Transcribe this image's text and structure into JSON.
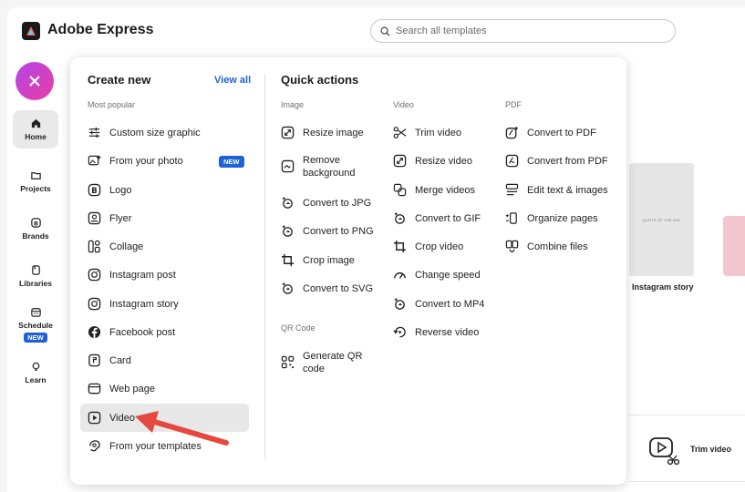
{
  "app": {
    "title": "Adobe Express"
  },
  "search": {
    "placeholder": "Search all templates"
  },
  "rail": {
    "items": [
      {
        "label": "Home",
        "icon": "home-icon"
      },
      {
        "label": "Projects",
        "icon": "folder-icon"
      },
      {
        "label": "Brands",
        "icon": "brand-icon"
      },
      {
        "label": "Libraries",
        "icon": "library-icon"
      },
      {
        "label": "Schedule",
        "icon": "calendar-icon",
        "badge": "NEW"
      },
      {
        "label": "Learn",
        "icon": "lightbulb-icon"
      }
    ]
  },
  "create_new": {
    "title": "Create new",
    "view_all": "View all",
    "section": "Most popular",
    "items": [
      {
        "label": "Custom size graphic",
        "icon": "sliders-icon"
      },
      {
        "label": "From your photo",
        "icon": "photo-magic-icon",
        "badge": "NEW"
      },
      {
        "label": "Logo",
        "icon": "logo-icon"
      },
      {
        "label": "Flyer",
        "icon": "flyer-icon"
      },
      {
        "label": "Collage",
        "icon": "collage-icon"
      },
      {
        "label": "Instagram post",
        "icon": "instagram-icon"
      },
      {
        "label": "Instagram story",
        "icon": "instagram-icon"
      },
      {
        "label": "Facebook post",
        "icon": "facebook-icon"
      },
      {
        "label": "Card",
        "icon": "card-icon"
      },
      {
        "label": "Web page",
        "icon": "webpage-icon"
      },
      {
        "label": "Video",
        "icon": "video-play-icon"
      },
      {
        "label": "From your templates",
        "icon": "templates-icon"
      }
    ]
  },
  "quick_actions": {
    "title": "Quick actions",
    "image": {
      "title": "Image",
      "items": [
        {
          "label": "Resize image"
        },
        {
          "label": "Remove background"
        },
        {
          "label": "Convert to JPG"
        },
        {
          "label": "Convert to PNG"
        },
        {
          "label": "Crop image"
        },
        {
          "label": "Convert to SVG"
        }
      ]
    },
    "qr": {
      "title": "QR Code",
      "items": [
        {
          "label": "Generate QR code"
        }
      ]
    },
    "video": {
      "title": "Video",
      "items": [
        {
          "label": "Trim video"
        },
        {
          "label": "Resize video"
        },
        {
          "label": "Merge videos"
        },
        {
          "label": "Convert to GIF"
        },
        {
          "label": "Crop video"
        },
        {
          "label": "Change speed"
        },
        {
          "label": "Convert to MP4"
        },
        {
          "label": "Reverse video"
        }
      ]
    },
    "pdf": {
      "title": "PDF",
      "items": [
        {
          "label": "Convert to PDF"
        },
        {
          "label": "Convert from PDF"
        },
        {
          "label": "Edit text & images"
        },
        {
          "label": "Organize pages"
        },
        {
          "label": "Combine files"
        }
      ]
    }
  },
  "background": {
    "template_label": "Instagram story",
    "template_text": "QUOTE OF THE DAY",
    "trim_label": "Trim video"
  },
  "colors": {
    "accent": "#1f62d8",
    "arrow": "#e5483f",
    "gradient_start": "#b445e8",
    "gradient_end": "#e63ea4"
  }
}
